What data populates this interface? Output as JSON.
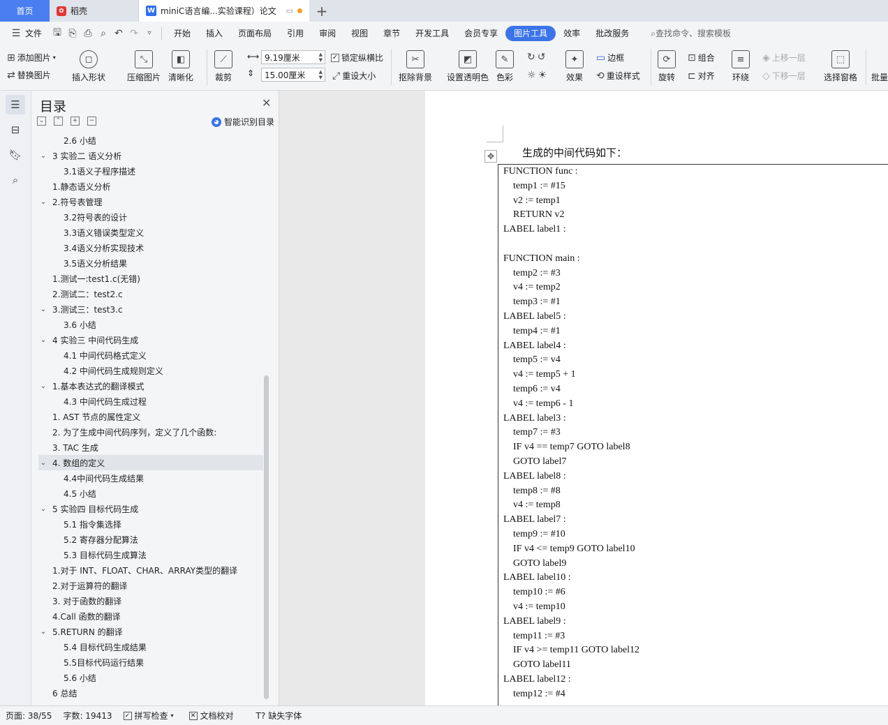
{
  "tabs": {
    "home": "首页",
    "daoke": "稻壳",
    "doc": "miniC语言编...实验课程）论文",
    "new_tab": "+"
  },
  "menu": {
    "file": "文件",
    "items": [
      "开始",
      "插入",
      "页面布局",
      "引用",
      "审阅",
      "视图",
      "章节",
      "开发工具",
      "会员专享",
      "图片工具",
      "效率",
      "批改服务"
    ],
    "search": "查找命令、搜索模板"
  },
  "ribbon": {
    "add_image": "添加图片",
    "replace_image": "替换图片",
    "insert_shape": "插入形状",
    "compress": "压缩图片",
    "clarity": "清晰化",
    "crop": "裁剪",
    "width": "9.19厘米",
    "height": "15.00厘米",
    "lock_ratio": "锁定纵横比",
    "reset_size": "重设大小",
    "remove_bg": "抠除背景",
    "transparent": "设置透明色",
    "color": "色彩",
    "effects": "效果",
    "border": "边框",
    "reset_style": "重设样式",
    "rotate": "旋转",
    "group": "组合",
    "align": "对齐",
    "wrap": "环绕",
    "bring_forward": "上移一层",
    "send_backward": "下移一层",
    "selection_pane": "选择窗格",
    "batch": "批量"
  },
  "toc": {
    "title": "目录",
    "smart": "智能识别目录",
    "items": [
      {
        "text": "2.6  小结",
        "level": 2,
        "caret": ""
      },
      {
        "text": "3  实验二  语义分析",
        "level": 1,
        "caret": "v"
      },
      {
        "text": "3.1语义子程序描述",
        "level": 2,
        "caret": ""
      },
      {
        "text": "1.静态语义分析",
        "level": 1,
        "caret": ""
      },
      {
        "text": "2.符号表管理",
        "level": 1,
        "caret": "v"
      },
      {
        "text": "3.2符号表的设计",
        "level": 2,
        "caret": ""
      },
      {
        "text": "3.3语义错误类型定义",
        "level": 2,
        "caret": ""
      },
      {
        "text": "3.4语义分析实现技术",
        "level": 2,
        "caret": ""
      },
      {
        "text": "3.5语义分析结果",
        "level": 2,
        "caret": ""
      },
      {
        "text": "1.测试一:test1.c(无错)",
        "level": 1,
        "caret": ""
      },
      {
        "text": "2.测试二：test2.c",
        "level": 1,
        "caret": ""
      },
      {
        "text": "3.测试三：test3.c",
        "level": 1,
        "caret": "v"
      },
      {
        "text": "3.6 小结",
        "level": 2,
        "caret": ""
      },
      {
        "text": "4  实验三  中间代码生成",
        "level": 1,
        "caret": "v"
      },
      {
        "text": "4.1  中间代码格式定义",
        "level": 2,
        "caret": ""
      },
      {
        "text": "4.2  中间代码生成规则定义",
        "level": 2,
        "caret": ""
      },
      {
        "text": "1.基本表达式的翻译模式",
        "level": 1,
        "caret": "v"
      },
      {
        "text": "4.3  中间代码生成过程",
        "level": 2,
        "caret": ""
      },
      {
        "text": "1.    AST 节点的属性定义",
        "level": 1,
        "caret": ""
      },
      {
        "text": "2.  为了生成中间代码序列，定义了几个函数:",
        "level": 1,
        "caret": ""
      },
      {
        "text": "3.  TAC 生成",
        "level": 1,
        "caret": ""
      },
      {
        "text": "4.  数组的定义",
        "level": 1,
        "caret": "v",
        "selected": true
      },
      {
        "text": "4.4中间代码生成结果",
        "level": 2,
        "caret": ""
      },
      {
        "text": "4.5  小结",
        "level": 2,
        "caret": ""
      },
      {
        "text": "5  实验四  目标代码生成",
        "level": 1,
        "caret": "v"
      },
      {
        "text": "5.1  指令集选择",
        "level": 2,
        "caret": ""
      },
      {
        "text": "5.2  寄存器分配算法",
        "level": 2,
        "caret": ""
      },
      {
        "text": "5.3  目标代码生成算法",
        "level": 2,
        "caret": ""
      },
      {
        "text": "1.对于 INT、FLOAT、CHAR、ARRAY类型的翻译",
        "level": 1,
        "caret": ""
      },
      {
        "text": "2.对于运算符的翻译",
        "level": 1,
        "caret": ""
      },
      {
        "text": "3.  对于函数的翻译",
        "level": 1,
        "caret": ""
      },
      {
        "text": "4.Call 函数的翻译",
        "level": 1,
        "caret": ""
      },
      {
        "text": "5.RETURN 的翻译",
        "level": 1,
        "caret": "v"
      },
      {
        "text": "5.4  目标代码生成结果",
        "level": 2,
        "caret": ""
      },
      {
        "text": "5.5目标代码运行结果",
        "level": 2,
        "caret": ""
      },
      {
        "text": "5.6  小结",
        "level": 2,
        "caret": ""
      },
      {
        "text": "6  总结",
        "level": 1,
        "caret": ""
      }
    ]
  },
  "document": {
    "intro": "生成的中间代码如下：",
    "code": [
      {
        "t": "FUNCTION func :",
        "i": 0
      },
      {
        "t": "temp1 := #15",
        "i": 1
      },
      {
        "t": "v2 := temp1",
        "i": 1
      },
      {
        "t": "RETURN v2",
        "i": 1
      },
      {
        "t": "LABEL label1 :",
        "i": 0
      },
      {
        "t": "",
        "i": 0
      },
      {
        "t": "FUNCTION main :",
        "i": 0
      },
      {
        "t": "temp2 := #3",
        "i": 1
      },
      {
        "t": "v4 := temp2",
        "i": 1
      },
      {
        "t": "temp3 := #1",
        "i": 1
      },
      {
        "t": "LABEL label5 :",
        "i": 0
      },
      {
        "t": "temp4 := #1",
        "i": 1
      },
      {
        "t": "LABEL label4 :",
        "i": 0
      },
      {
        "t": "temp5 := v4",
        "i": 1
      },
      {
        "t": "v4 := temp5 + 1",
        "i": 1
      },
      {
        "t": "temp6 := v4",
        "i": 1
      },
      {
        "t": "v4 := temp6 - 1",
        "i": 1
      },
      {
        "t": "LABEL label3 :",
        "i": 0
      },
      {
        "t": "temp7 := #3",
        "i": 1
      },
      {
        "t": "IF v4 == temp7 GOTO label8",
        "i": 1
      },
      {
        "t": "GOTO label7",
        "i": 1
      },
      {
        "t": "LABEL label8 :",
        "i": 0
      },
      {
        "t": "temp8 := #8",
        "i": 1
      },
      {
        "t": "v4 := temp8",
        "i": 1
      },
      {
        "t": "LABEL label7 :",
        "i": 0
      },
      {
        "t": "temp9 := #10",
        "i": 1
      },
      {
        "t": "IF v4 <= temp9 GOTO label10",
        "i": 1
      },
      {
        "t": "GOTO label9",
        "i": 1
      },
      {
        "t": "LABEL label10 :",
        "i": 0
      },
      {
        "t": "temp10 := #6",
        "i": 1
      },
      {
        "t": "v4 := temp10",
        "i": 1
      },
      {
        "t": "LABEL label9 :",
        "i": 0
      },
      {
        "t": "temp11 := #3",
        "i": 1
      },
      {
        "t": "IF v4 >= temp11 GOTO label12",
        "i": 1
      },
      {
        "t": "GOTO label11",
        "i": 1
      },
      {
        "t": "LABEL label12 :",
        "i": 0
      },
      {
        "t": "temp12 := #4",
        "i": 1
      }
    ]
  },
  "status": {
    "page": "页面: 38/55",
    "words": "字数: 19413",
    "spell": "拼写检查",
    "proof": "文档校对",
    "missing_font": "缺失字体"
  }
}
